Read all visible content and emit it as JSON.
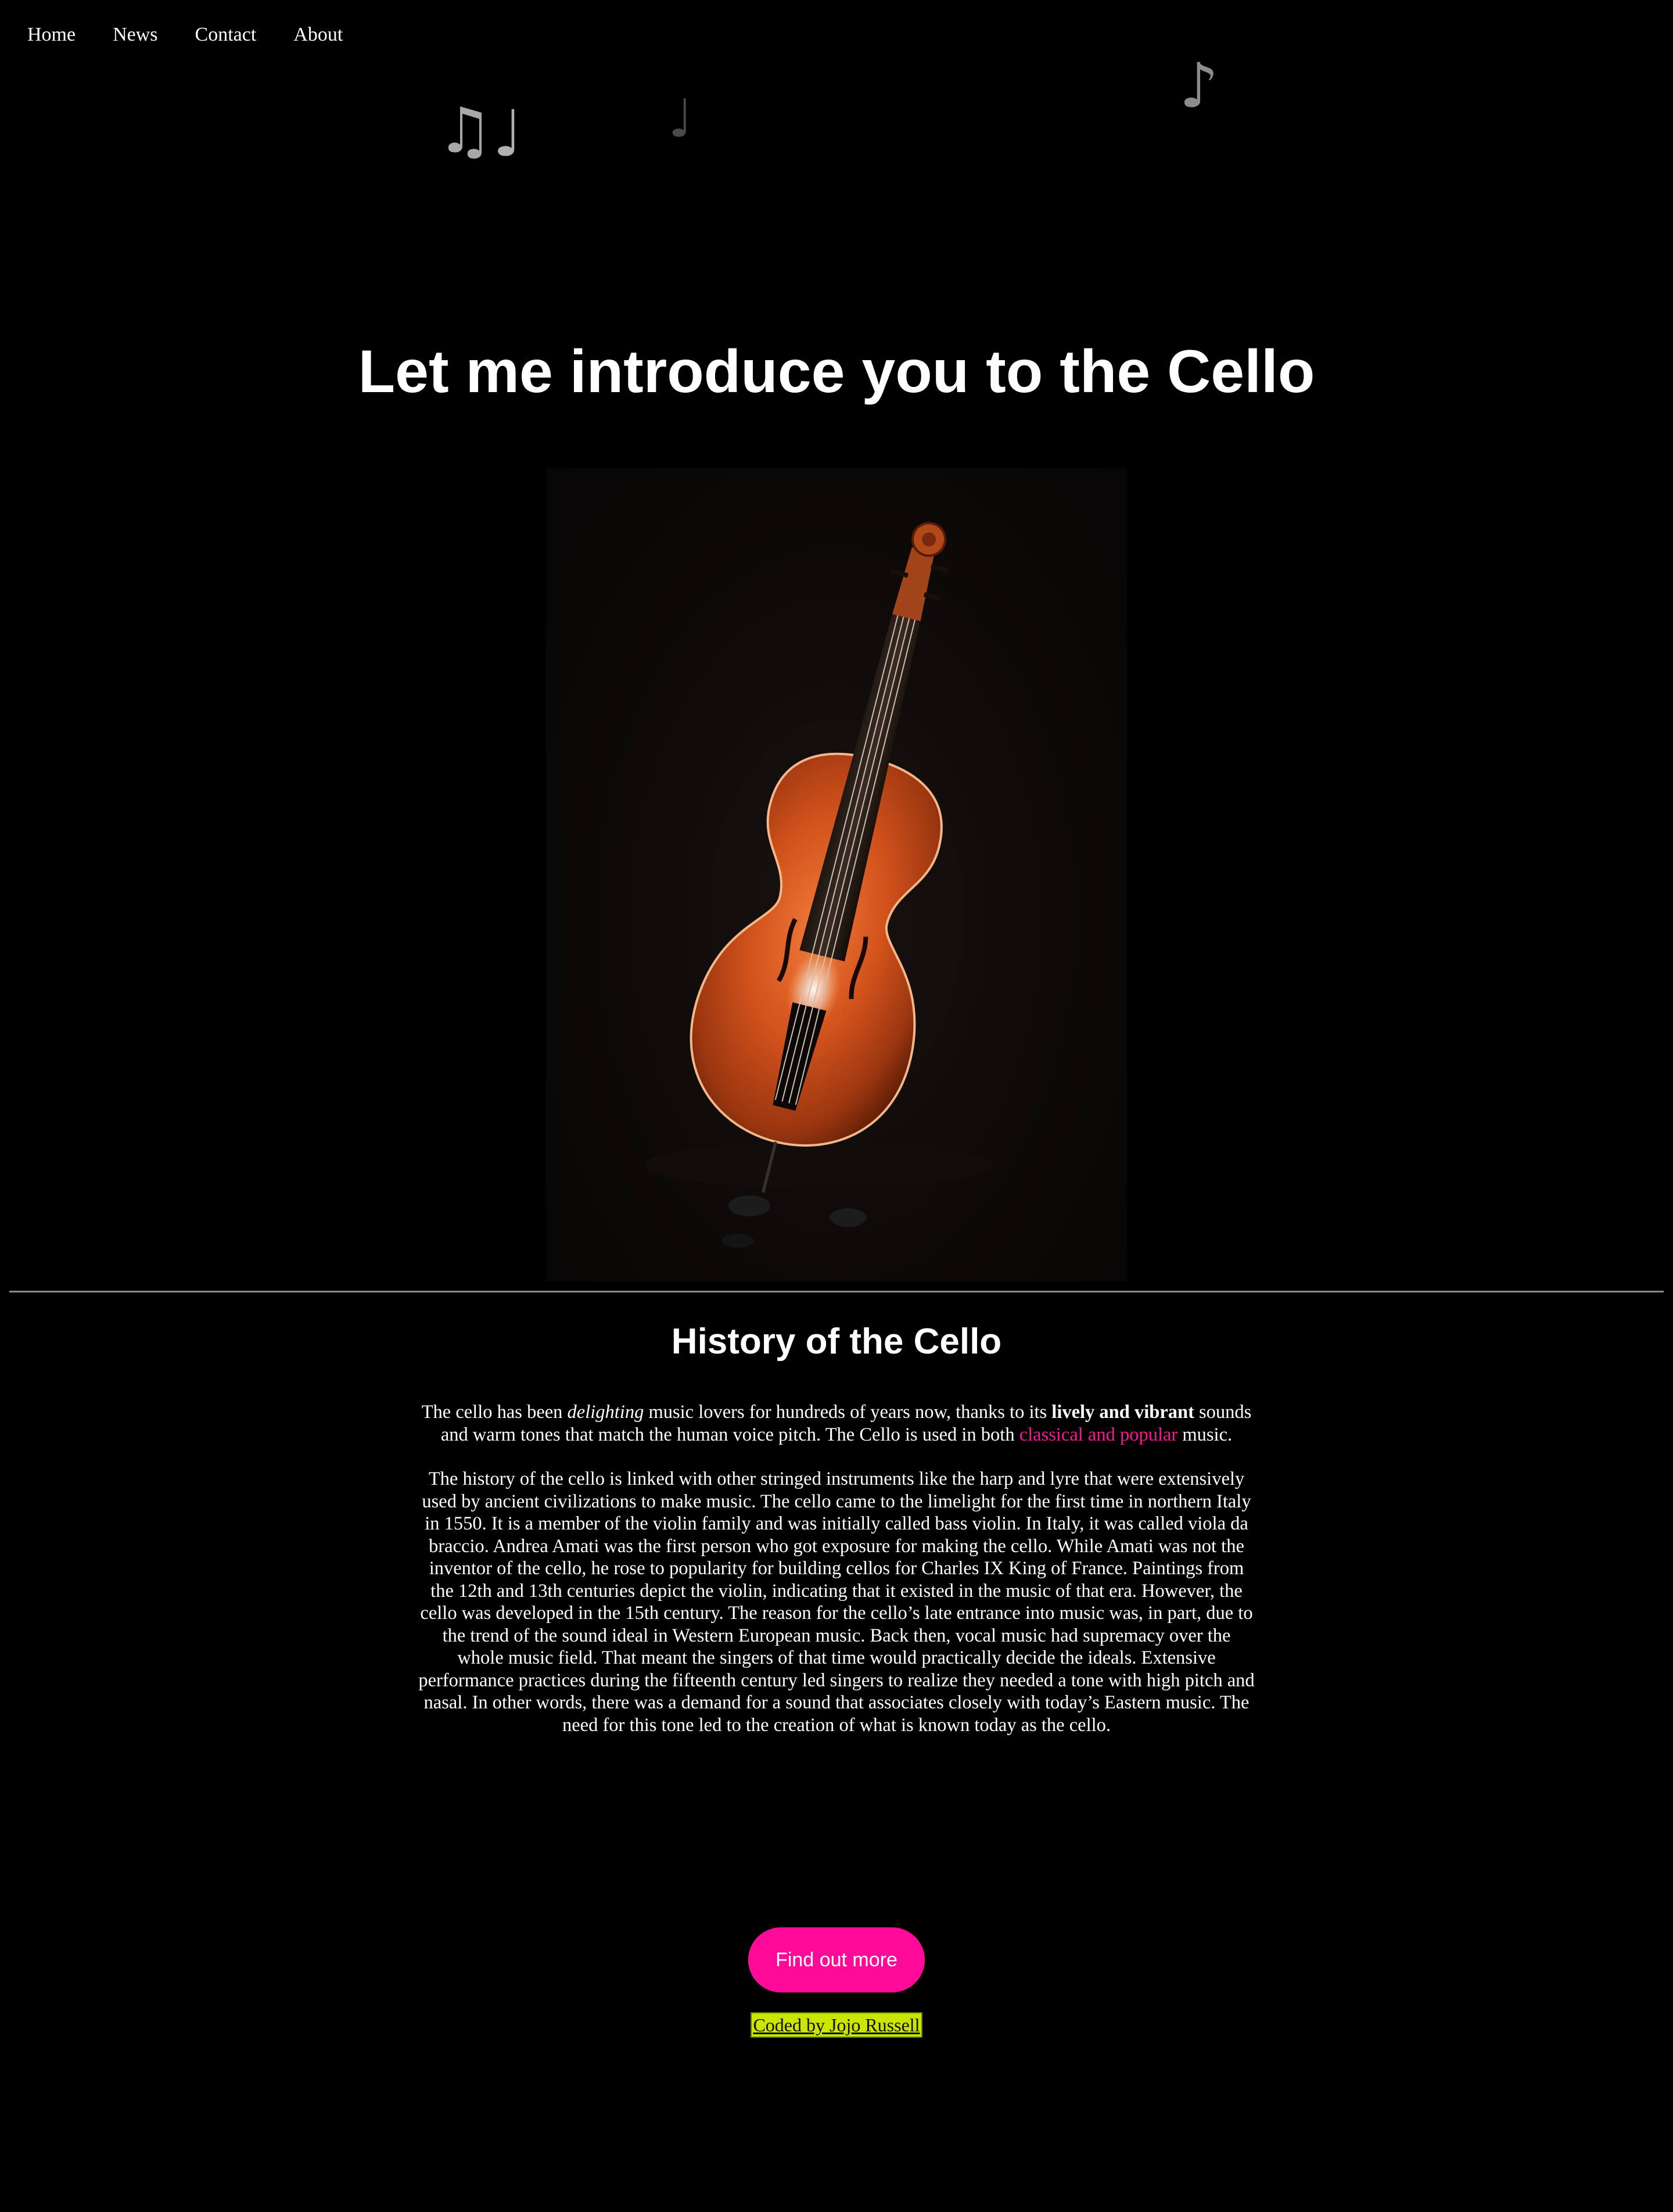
{
  "nav": {
    "items": [
      {
        "label": "Home"
      },
      {
        "label": "News"
      },
      {
        "label": "Contact"
      },
      {
        "label": "About"
      }
    ]
  },
  "decor": {
    "notes": [
      "♫",
      "♩",
      "♩",
      "♪"
    ]
  },
  "hero": {
    "title": "Let me introduce you to the Cello"
  },
  "history": {
    "heading": "History of the Cello",
    "p1": {
      "part1": "The cello has been ",
      "em": "delighting",
      "part2": " music lovers for hundreds of years now, thanks to its ",
      "strong": "lively and vibrant",
      "part3": " sounds and warm tones that match the human voice pitch. The Cello is used in both ",
      "link": "classical and popular",
      "part4": " music."
    },
    "p2": "The history of the cello is linked with other stringed instruments like the harp and lyre that were extensively used by ancient civilizations to make music. The cello came to the limelight for the first time in northern Italy in 1550. It is a member of the violin family and was initially called bass violin. In Italy, it was called viola da braccio. Andrea Amati was the first person who got exposure for making the cello. While Amati was not the inventor of the cello, he rose to popularity for building cellos for Charles IX King of France. Paintings from the 12th and 13th centuries depict the violin, indicating that it existed in the music of that era. However, the cello was developed in the 15th century. The reason for the cello’s late entrance into music was, in part, due to the trend of the sound ideal in Western European music. Back then, vocal music had supremacy over the whole music field. That meant the singers of that time would practically decide the ideals. Extensive performance practices during the fifteenth century led singers to realize they needed a tone with high pitch and nasal. In other words, there was a demand for a sound that associates closely with today’s Eastern music. The need for this tone led to the creation of what is known today as the cello."
  },
  "cta": {
    "label": "Find out more"
  },
  "footer": {
    "credit": "Coded by Jojo Russell"
  },
  "colors": {
    "background": "#000000",
    "accent_pink": "#ff0a99",
    "link_pink": "#ff1493",
    "credit_highlight": "#c8e600"
  }
}
